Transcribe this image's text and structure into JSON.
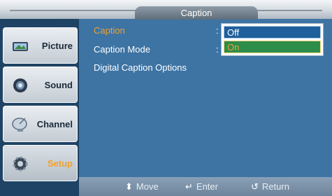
{
  "title": "Caption",
  "sidebar": {
    "items": [
      {
        "label": "Picture",
        "icon": "picture-icon"
      },
      {
        "label": "Sound",
        "icon": "sound-icon"
      },
      {
        "label": "Channel",
        "icon": "channel-icon"
      },
      {
        "label": "Setup",
        "icon": "setup-icon"
      }
    ],
    "active_index": 3
  },
  "menu": {
    "rows": [
      "Caption",
      "Caption Mode",
      "Digital Caption Options"
    ],
    "selected_index": 0,
    "colon": ":"
  },
  "dropdown": {
    "options": [
      "Off",
      "On"
    ],
    "highlighted": "Off",
    "focused": "On"
  },
  "hints": {
    "move": "Move",
    "enter": "Enter",
    "return": "Return"
  },
  "colors": {
    "background": "#3d74a4",
    "accent": "#f0a030",
    "sidebar": "#1e4364"
  }
}
